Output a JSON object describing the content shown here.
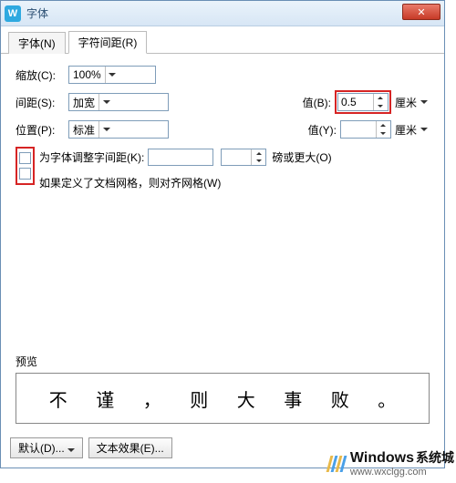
{
  "window": {
    "title": "字体"
  },
  "tabs": {
    "font": "字体(N)",
    "spacing": "字符间距(R)"
  },
  "scale": {
    "label": "缩放(C):",
    "value": "100%"
  },
  "spacing": {
    "label": "间距(S):",
    "value": "加宽",
    "valueB_label": "值(B):",
    "valueB": "0.5",
    "unit": "厘米"
  },
  "position": {
    "label": "位置(P):",
    "value": "标准",
    "valueY_label": "值(Y):",
    "valueY": "",
    "unit": "厘米"
  },
  "kerning": {
    "label": "为字体调整字间距(K):",
    "suffix": "磅或更大(O)"
  },
  "grid": {
    "label": "如果定义了文档网格，则对齐网格(W)"
  },
  "preview": {
    "label": "预览",
    "chars": [
      "不",
      "谨",
      "，",
      "则",
      "大",
      "事",
      "败",
      "。"
    ]
  },
  "footer": {
    "default": "默认(D)...",
    "effect": "文本效果(E)..."
  },
  "watermark": {
    "brand": "Windows",
    "sub": "系统城",
    "url": "www.wxclgg.com"
  }
}
